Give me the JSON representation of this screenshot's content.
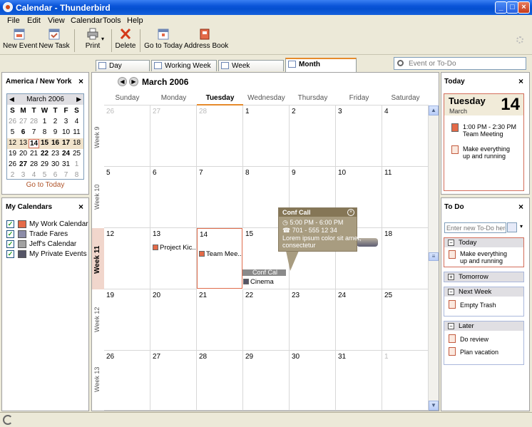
{
  "window": {
    "title": "Calendar - Thunderbird"
  },
  "menu": [
    "File",
    "Edit",
    "View",
    "Calendar",
    "Tools",
    "Help"
  ],
  "toolbar": {
    "new_event": "New Event",
    "new_task": "New Task",
    "print": "Print",
    "delete": "Delete",
    "go_to_today": "Go to Today",
    "address_book": "Address Book"
  },
  "view_tabs": [
    "Day",
    "Working Week",
    "Week",
    "Month"
  ],
  "search": {
    "placeholder": "Event or To-Do"
  },
  "left": {
    "timezone_header": "America / New York",
    "minical": {
      "month_label": "March 2006",
      "dow": [
        "S",
        "M",
        "T",
        "W",
        "T",
        "F",
        "S"
      ],
      "go_to_today": "Go to Today"
    },
    "calendars_header": "My Calendars",
    "calendars": [
      {
        "name": "My Work Calendar",
        "color": "#e46a48"
      },
      {
        "name": "Trade Fares",
        "color": "#8c8ca8"
      },
      {
        "name": "Jeff's Calendar",
        "color": "#a2a2a2"
      },
      {
        "name": "My Private Events",
        "color": "#555566"
      }
    ]
  },
  "month": {
    "title": "March 2006",
    "days": [
      "Sunday",
      "Monday",
      "Tuesday",
      "Wednesday",
      "Thursday",
      "Friday",
      "Saturday"
    ],
    "weeks": [
      "Week 9",
      "Week 10",
      "Week 11",
      "Week 12",
      "Week 13"
    ],
    "events": {
      "project": "Project Kic...",
      "team": "Team Mee...",
      "conf": "Conf Cal",
      "cinema": "Cinema"
    }
  },
  "popup": {
    "title": "Conf Call",
    "time": "5:00 PM - 6:00 PM",
    "phone": "701 - 555 12 34",
    "body": "Lorem ipsum color sit amet,",
    "body2": "consectetur"
  },
  "today_pane": {
    "header": "Today",
    "dow": "Tuesday",
    "month": "March",
    "day": "14",
    "item1_time": "1:00 PM - 2:30 PM",
    "item1_title": "Team Meeting",
    "item2_title_1": "Make everything",
    "item2_title_2": "up and running"
  },
  "todo_pane": {
    "header": "To Do",
    "input_placeholder": "Enter new To-Do here",
    "groups": {
      "today": "Today",
      "today_item_1": "Make everything",
      "today_item_2": "up and running",
      "tomorrow": "Tomorrow",
      "next_week": "Next Week",
      "next_week_item": "Empty Trash",
      "later": "Later",
      "later_item_1": "Do review",
      "later_item_2": "Plan vacation"
    }
  },
  "colors": {
    "accent_orange": "#e68b2c",
    "today_border": "#d36d5a",
    "popup_bg": "#a89c80"
  }
}
